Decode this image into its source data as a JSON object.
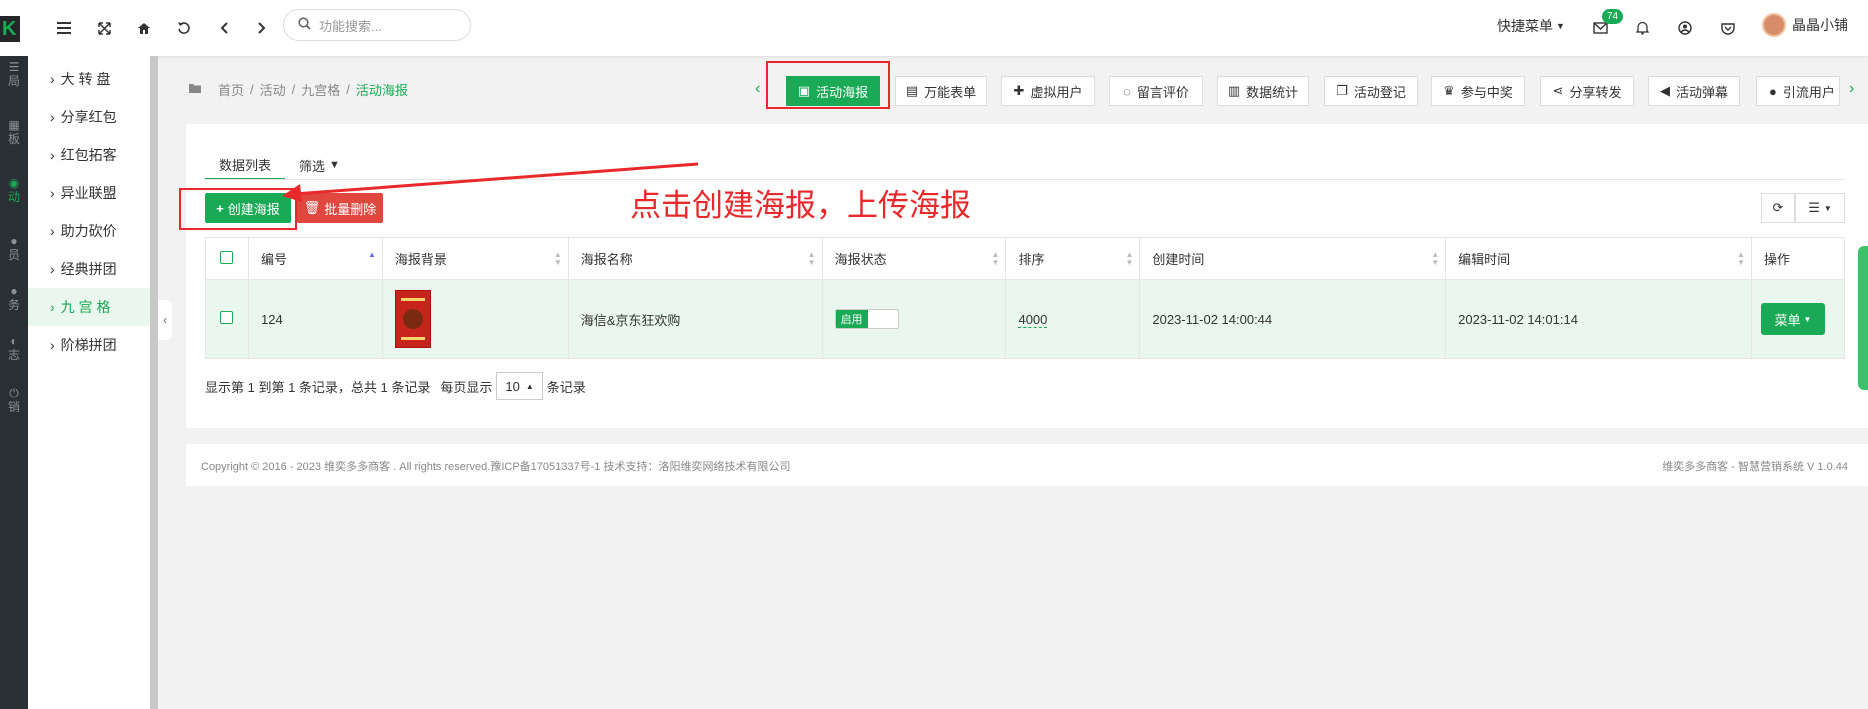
{
  "header": {
    "search_placeholder": "功能搜索...",
    "quick_menu": "快捷菜单",
    "message_count": "74",
    "user_name": "晶晶小铺"
  },
  "left_strip": {
    "logo": "K",
    "labels": [
      "局",
      "板",
      "动",
      "员",
      "务",
      "志",
      "销"
    ]
  },
  "submenu": {
    "items": [
      {
        "label": "大 转 盘",
        "active": false
      },
      {
        "label": "分享红包",
        "active": false
      },
      {
        "label": "红包拓客",
        "active": false
      },
      {
        "label": "异业联盟",
        "active": false
      },
      {
        "label": "助力砍价",
        "active": false
      },
      {
        "label": "经典拼团",
        "active": false
      },
      {
        "label": "九 宫 格",
        "active": true
      },
      {
        "label": "阶梯拼团",
        "active": false
      }
    ]
  },
  "breadcrumb": {
    "home": "首页",
    "sep": "/",
    "level1": "活动",
    "level2": "九宫格",
    "current": "活动海报"
  },
  "tabs": [
    {
      "label": "活动海报",
      "icon": "file-image-icon",
      "active": true
    },
    {
      "label": "万能表单",
      "icon": "file-text-icon",
      "active": false
    },
    {
      "label": "虚拟用户",
      "icon": "user-plus-icon",
      "active": false
    },
    {
      "label": "留言评价",
      "icon": "comments-icon",
      "active": false
    },
    {
      "label": "数据统计",
      "icon": "bar-chart-icon",
      "active": false
    },
    {
      "label": "活动登记",
      "icon": "copy-icon",
      "active": false
    },
    {
      "label": "参与中奖",
      "icon": "trophy-icon",
      "active": false
    },
    {
      "label": "分享转发",
      "icon": "share-icon",
      "active": false
    },
    {
      "label": "活动弹幕",
      "icon": "bullhorn-icon",
      "active": false
    },
    {
      "label": "引流用户",
      "icon": "users-icon",
      "active": false
    }
  ],
  "subtabs": {
    "list": "数据列表",
    "filter": "筛选"
  },
  "toolbar": {
    "create": "创建海报",
    "batch_delete": "批量删除"
  },
  "annotation": {
    "text": "点击创建海报，上传海报"
  },
  "table": {
    "columns": [
      "编号",
      "海报背景",
      "海报名称",
      "海报状态",
      "排序",
      "创建时间",
      "编辑时间",
      "操作"
    ],
    "rows": [
      {
        "id": "124",
        "name": "海信&京东狂欢购",
        "status": "启用",
        "sort": "4000",
        "created": "2023-11-02 14:00:44",
        "edited": "2023-11-02 14:01:14",
        "action": "菜单"
      }
    ]
  },
  "pager": {
    "summary": "显示第 1 到第 1 条记录，总共 1 条记录",
    "per_page_label": "每页显示",
    "per_page": "10",
    "records_suffix": "条记录"
  },
  "footer": {
    "copyright": "Copyright © 2016 - 2023 维奕多多商客 . All rights reserved.豫ICP备17051337号-1 技术支持：洛阳维奕网络技术有限公司",
    "version": "维奕多多商客 - 智慧营销系统 V 1.0.44"
  },
  "colors": {
    "accent": "#1aaa55",
    "danger": "#e0473f",
    "annotation": "#e8282a"
  }
}
